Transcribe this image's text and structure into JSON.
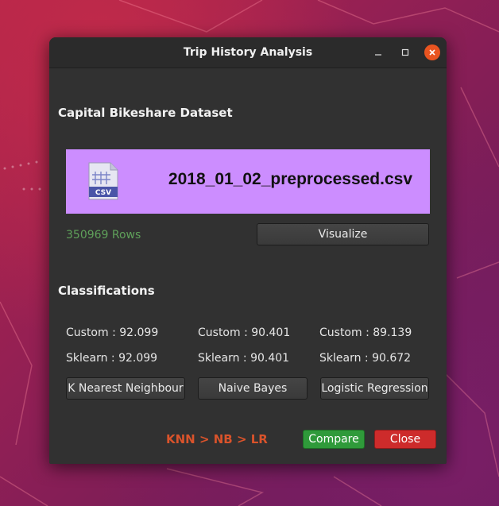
{
  "window": {
    "title": "Trip History Analysis",
    "controls": {
      "minimize": "–",
      "maximize": "□",
      "close": "×"
    }
  },
  "dataset": {
    "heading": "Capital Bikeshare Dataset",
    "file_name": "2018_01_02_preprocessed.csv",
    "file_icon_label": "CSV",
    "rows": "350969 Rows",
    "visualize_label": "Visualize"
  },
  "classifications": {
    "heading": "Classifications",
    "models": [
      {
        "custom": "Custom : 92.099",
        "sklearn": "Sklearn : 92.099",
        "button": "K Nearest Neighbour"
      },
      {
        "custom": "Custom : 90.401",
        "sklearn": "Sklearn : 90.401",
        "button": "Naive Bayes"
      },
      {
        "custom": "Custom : 89.139",
        "sklearn": "Sklearn : 90.672",
        "button": "Logistic Regression"
      }
    ]
  },
  "footer": {
    "ranking": "KNN > NB > LR",
    "compare_label": "Compare",
    "close_label": "Close"
  },
  "colors": {
    "banner": "#cc8dff",
    "rows_text": "#5fa15a",
    "ranking_text": "#d9532b",
    "compare": "#2f9a3a",
    "close": "#cd2b2b",
    "title_close": "#e95420"
  }
}
